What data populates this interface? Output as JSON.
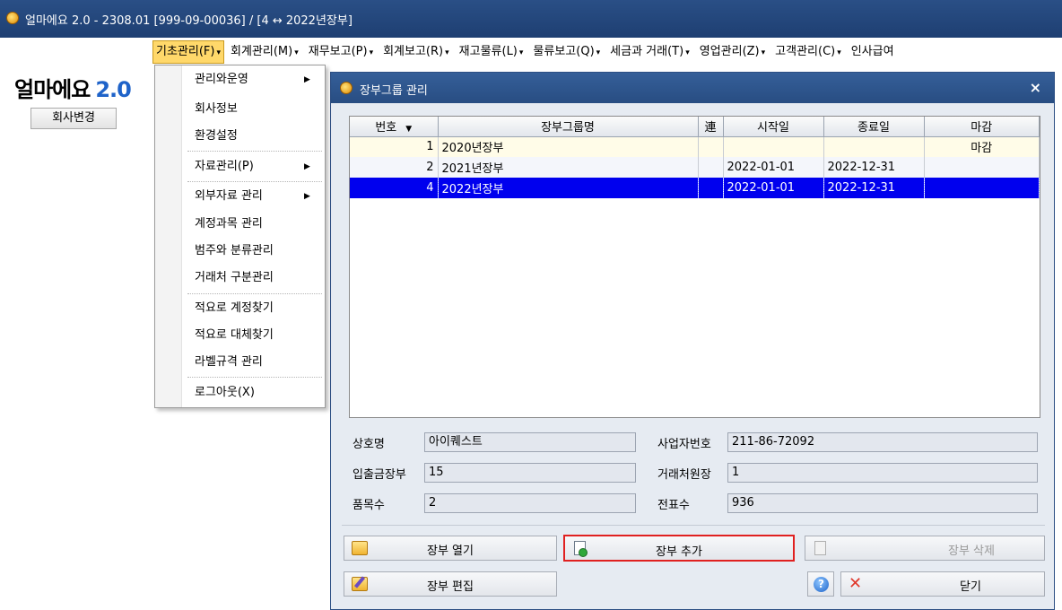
{
  "window": {
    "title": "얼마에요 2.0 - 2308.01 [999-09-00036] / [4 ↔ 2022년장부]"
  },
  "menubar": [
    {
      "label": "기초관리(F)"
    },
    {
      "label": "회계관리(M)"
    },
    {
      "label": "재무보고(P)"
    },
    {
      "label": "회계보고(R)"
    },
    {
      "label": "재고물류(L)"
    },
    {
      "label": "물류보고(Q)"
    },
    {
      "label": "세금과 거래(T)"
    },
    {
      "label": "영업관리(Z)"
    },
    {
      "label": "고객관리(C)"
    },
    {
      "label": "인사급여"
    }
  ],
  "sidebar": {
    "logo_name": "얼마에요",
    "logo_version": "2.0",
    "change_company": "회사변경"
  },
  "dropdown": {
    "items": [
      {
        "label": "관리와운영",
        "submenu": true
      },
      {
        "label": "회사정보"
      },
      {
        "label": "환경설정"
      },
      {
        "label": "자료관리(P)",
        "submenu": true
      },
      {
        "label": "외부자료 관리",
        "submenu": true
      },
      {
        "label": "계정과목 관리"
      },
      {
        "label": "범주와 분류관리"
      },
      {
        "label": "거래처 구분관리"
      },
      {
        "label": "적요로 계정찾기"
      },
      {
        "label": "적요로 대체찾기"
      },
      {
        "label": "라벨규격 관리"
      },
      {
        "label": "로그아웃(X)"
      }
    ],
    "arrow": "▶"
  },
  "dialog": {
    "title": "장부그룹 관리",
    "close": "×",
    "grid": {
      "headers": [
        "번호",
        "장부그룹명",
        "連",
        "시작일",
        "종료일",
        "마감"
      ],
      "rows": [
        {
          "no": "1",
          "name": "2020년장부",
          "link": "",
          "start": "",
          "end": "",
          "closed": "마감"
        },
        {
          "no": "2",
          "name": "2021년장부",
          "link": "",
          "start": "2022-01-01",
          "end": "2022-12-31",
          "closed": ""
        },
        {
          "no": "4",
          "name": "2022년장부",
          "link": "",
          "start": "2022-01-01",
          "end": "2022-12-31",
          "closed": ""
        }
      ],
      "selected_row": 3
    },
    "info": {
      "company_label": "상호명",
      "company_value": "아이퀘스트",
      "bizno_label": "사업자번호",
      "bizno_value": "211-86-72092",
      "cashbook_label": "입출금장부",
      "cashbook_value": "15",
      "client_ledger_label": "거래처원장",
      "client_ledger_value": "1",
      "items_label": "품목수",
      "items_value": "2",
      "vouchers_label": "전표수",
      "vouchers_value": "936"
    },
    "buttons": {
      "open": "장부 열기",
      "add": "장부 추가",
      "delete": "장부 삭제",
      "edit": "장부 편집",
      "close": "닫기"
    }
  }
}
